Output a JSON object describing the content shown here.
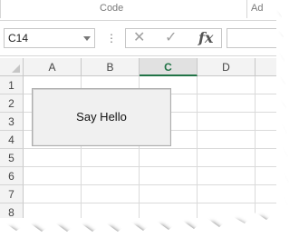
{
  "ribbon": {
    "group_label": "Code",
    "group_label_partial": "Ad"
  },
  "formula_bar": {
    "name_box": "C14",
    "cancel_icon": "x-icon",
    "enter_icon": "check-icon",
    "fx_label": "fx"
  },
  "sheet": {
    "columns": [
      "A",
      "B",
      "C",
      "D"
    ],
    "active_column": "C",
    "rows": [
      "1",
      "2",
      "3",
      "4",
      "5",
      "6",
      "7",
      "8"
    ]
  },
  "button": {
    "label": "Say Hello"
  }
}
